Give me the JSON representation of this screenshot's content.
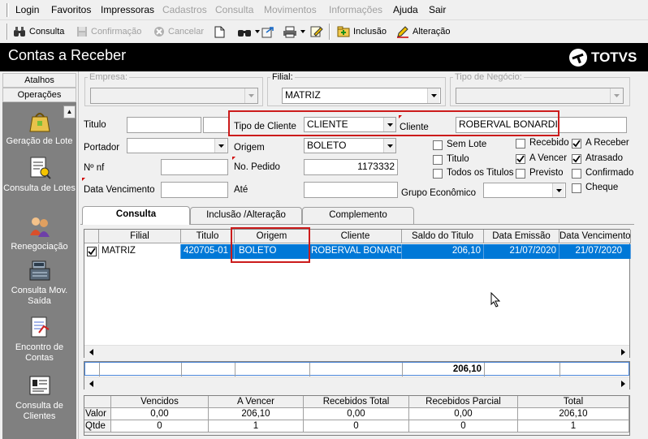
{
  "menu": {
    "items": [
      {
        "label": "Login",
        "enabled": true
      },
      {
        "label": "Favoritos",
        "enabled": true
      },
      {
        "label": "Impressoras",
        "enabled": true
      },
      {
        "label": "Cadastros",
        "enabled": false
      },
      {
        "label": "Consulta",
        "enabled": false
      },
      {
        "label": "Movimentos",
        "enabled": false
      },
      {
        "label": "Informações",
        "enabled": false
      },
      {
        "label": "Ajuda",
        "enabled": true
      },
      {
        "label": "Sair",
        "enabled": true
      }
    ]
  },
  "toolbar": {
    "consulta": "Consulta",
    "confirmacao": "Confirmação",
    "cancelar": "Cancelar",
    "inclusao": "Inclusão",
    "alteracao": "Alteração"
  },
  "window": {
    "title": "Contas a Receber",
    "brand": "TOTVS"
  },
  "sidebar": {
    "atalhos": "Atalhos",
    "operacoes": "Operações",
    "items": [
      {
        "label": "Geração de Lote",
        "icon": "bag-icon"
      },
      {
        "label": "Consulta de Lotes",
        "icon": "document-search-icon"
      },
      {
        "label": "Renegociação",
        "icon": "people-icon"
      },
      {
        "label": "Consulta Mov. Saída",
        "icon": "cash-register-icon"
      },
      {
        "label": "Encontro de Contas",
        "icon": "document-check-icon"
      },
      {
        "label": "Consulta de Clientes",
        "icon": "client-card-icon"
      }
    ]
  },
  "filters": {
    "empresa_label": "Empresa:",
    "empresa_value": "",
    "filial_label": "Filial:",
    "filial_value": "MATRIZ",
    "tipo_negocio_label": "Tipo de Negócio:",
    "tipo_negocio_value": "",
    "titulo_label": "Titulo",
    "titulo_value": "",
    "tipo_cliente_label": "Tipo de Cliente",
    "tipo_cliente_value": "CLIENTE",
    "cliente_label": "Cliente",
    "cliente_value": "ROBERVAL BONARDI",
    "portador_label": "Portador",
    "portador_value": "",
    "origem_label": "Origem",
    "origem_value": "BOLETO",
    "nf_label": "Nº nf",
    "nf_value": "",
    "pedido_label": "No. Pedido",
    "pedido_value": "1173332",
    "data_venc_label": "Data Vencimento",
    "data_venc_value": "",
    "ate_label": "Até",
    "ate_value": "",
    "grupo_label": "Grupo Econômico",
    "grupo_value": ""
  },
  "checkboxes": [
    {
      "label": "Sem Lote",
      "checked": false
    },
    {
      "label": "Titulo",
      "checked": false
    },
    {
      "label": "Todos os Titulos",
      "checked": false
    },
    {
      "label": "Recebido",
      "checked": false
    },
    {
      "label": "A Vencer",
      "checked": true
    },
    {
      "label": "Previsto",
      "checked": false
    },
    {
      "label": "A Receber",
      "checked": true
    },
    {
      "label": "Atrasado",
      "checked": true
    },
    {
      "label": "Confirmado",
      "checked": false
    },
    {
      "label": "Cheque",
      "checked": false
    }
  ],
  "tabs": [
    {
      "label": "Consulta",
      "active": true
    },
    {
      "label": "Inclusão /Alteração",
      "active": false
    },
    {
      "label": "Complemento",
      "active": false
    }
  ],
  "grid": {
    "columns": [
      "Filial",
      "Titulo",
      "Origem",
      "Cliente",
      "Saldo do Titulo",
      "Data Emissão",
      "Data Vencimento"
    ],
    "rows": [
      {
        "checked": true,
        "filial": "MATRIZ",
        "titulo": "420705-01",
        "origem": "BOLETO",
        "cliente": "ROBERVAL BONARDI",
        "saldo": "206,10",
        "emissao": "21/07/2020",
        "vencimento": "21/07/2020"
      }
    ],
    "total_saldo": "206,10"
  },
  "summary": {
    "columns": [
      "Vencidos",
      "A Vencer",
      "Recebidos Total",
      "Recebidos Parcial",
      "Total"
    ],
    "rows": [
      {
        "label": "Valor",
        "values": [
          "0,00",
          "206,10",
          "0,00",
          "0,00",
          "206,10"
        ]
      },
      {
        "label": "Qtde",
        "values": [
          "0",
          "1",
          "0",
          "0",
          "1"
        ]
      }
    ]
  }
}
